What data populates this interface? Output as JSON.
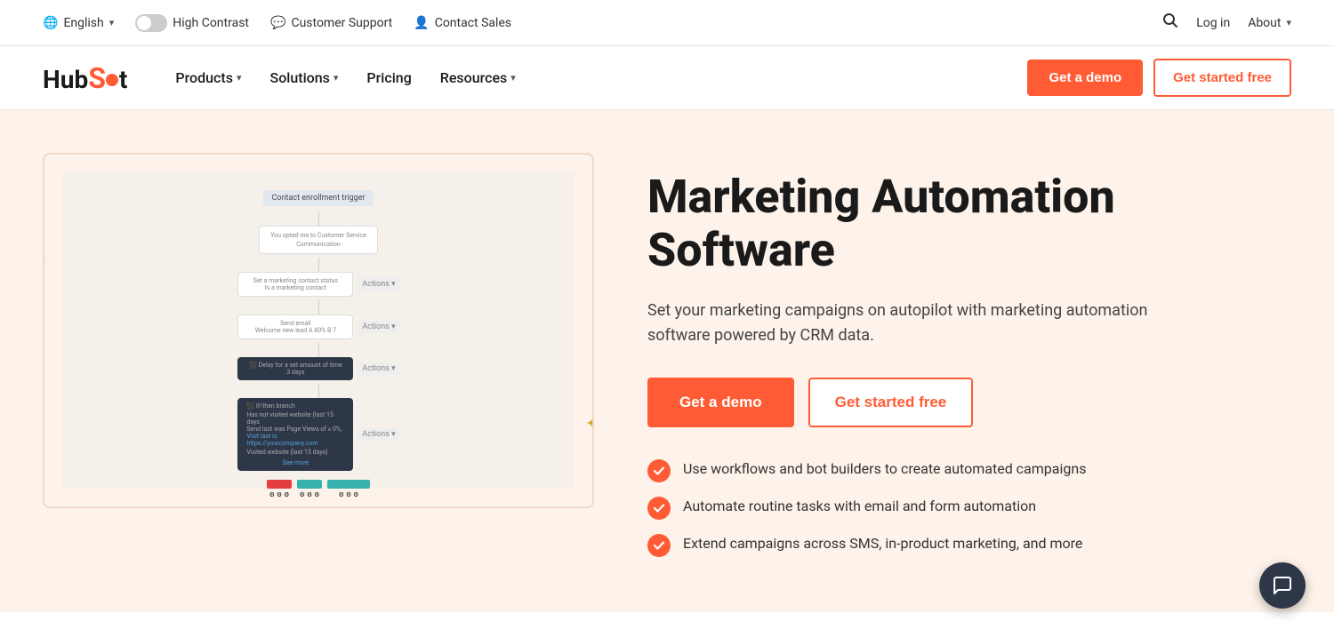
{
  "utility_bar": {
    "language": "English",
    "language_icon": "🌐",
    "high_contrast": "High Contrast",
    "customer_support": "Customer Support",
    "contact_sales": "Contact Sales",
    "login": "Log in",
    "about": "About"
  },
  "nav": {
    "logo_hub": "Hub",
    "logo_spot": "Sp",
    "logo_dot": "o",
    "logo_t": "t",
    "products": "Products",
    "solutions": "Solutions",
    "pricing": "Pricing",
    "resources": "Resources",
    "get_demo": "Get a demo",
    "get_started": "Get started free"
  },
  "hero": {
    "title": "Marketing Automation Software",
    "subtitle": "Set your marketing campaigns on autopilot with marketing automation software powered by CRM data.",
    "btn_demo": "Get a demo",
    "btn_free": "Get started free",
    "features": [
      "Use workflows and bot builders to create automated campaigns",
      "Automate routine tasks with email and form automation",
      "Extend campaigns across SMS, in-product marketing, and more"
    ]
  },
  "chat": {
    "icon": "💬"
  }
}
